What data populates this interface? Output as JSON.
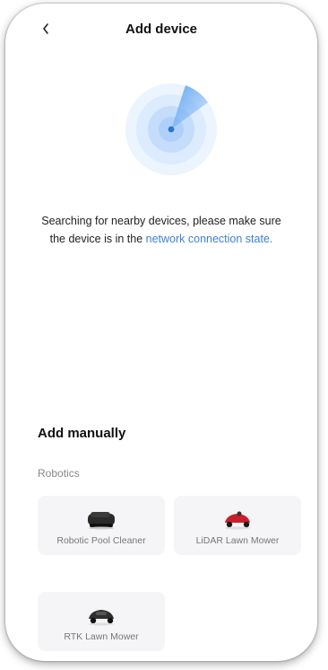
{
  "header": {
    "title": "Add device",
    "back_icon": "chevron-left-icon"
  },
  "search": {
    "line1": "Searching for nearby devices, please make sure",
    "line2_prefix": "the device is in the ",
    "link_text": "network connection state.",
    "link_color": "#3d7fd9",
    "radar_color": "#4a90e2"
  },
  "manual": {
    "title": "Add manually",
    "category": "Robotics",
    "devices": [
      {
        "label": "Robotic Pool Cleaner",
        "icon": "pool-cleaner-icon",
        "color": "#222222"
      },
      {
        "label": "LiDAR Lawn Mower",
        "icon": "lawn-mower-icon",
        "color": "#c8202a"
      },
      {
        "label": "RTK Lawn Mower",
        "icon": "lawn-mower-icon",
        "color": "#2e2e2e"
      }
    ]
  }
}
